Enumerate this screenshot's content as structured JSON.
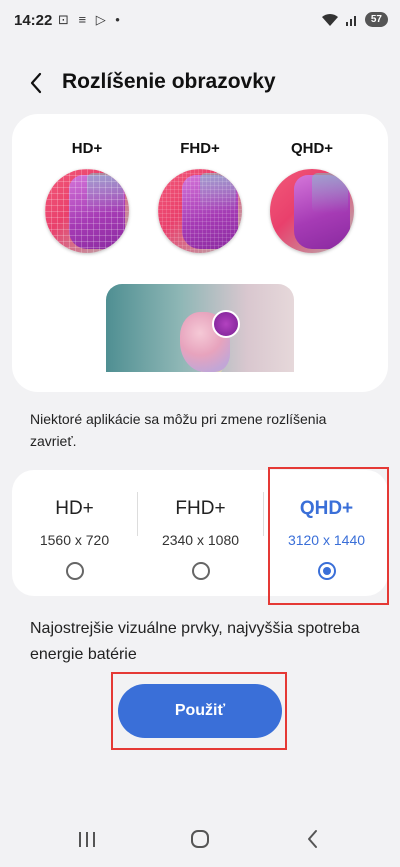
{
  "status_bar": {
    "time": "14:22",
    "icons": "⊡ ≡ ▷ •",
    "battery": "57"
  },
  "header": {
    "title": "Rozlíšenie obrazovky"
  },
  "preview": {
    "labels": [
      "HD+",
      "FHD+",
      "QHD+"
    ]
  },
  "info_text": "Niektoré aplikácie sa môžu pri zmene rozlíšenia zavrieť.",
  "options": [
    {
      "name": "HD+",
      "dims": "1560 x 720",
      "selected": false
    },
    {
      "name": "FHD+",
      "dims": "2340 x 1080",
      "selected": false
    },
    {
      "name": "QHD+",
      "dims": "3120 x 1440",
      "selected": true
    }
  ],
  "description": "Najostrejšie vizuálne prvky, najvyššia spotreba energie batérie",
  "apply_button": "Použiť",
  "colors": {
    "accent": "#3a6fd8",
    "highlight": "#e53935",
    "background": "#f2f2f4"
  }
}
